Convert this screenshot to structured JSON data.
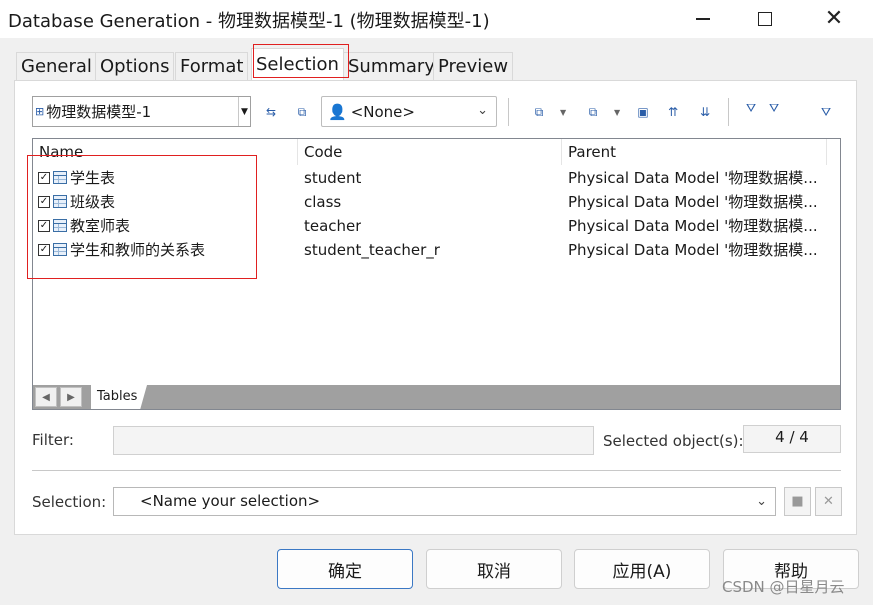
{
  "window": {
    "title": "Database Generation - 物理数据模型-1 (物理数据模型-1)"
  },
  "tabs": [
    {
      "label": "General"
    },
    {
      "label": "Options"
    },
    {
      "label": "Format"
    },
    {
      "label": "Selection"
    },
    {
      "label": "Summary"
    },
    {
      "label": "Preview"
    }
  ],
  "toolbar": {
    "model_value": "物理数据模型-1",
    "owner_value": "<None>"
  },
  "list": {
    "columns": [
      "Name",
      "Code",
      "Parent"
    ],
    "rows": [
      {
        "name": "学生表",
        "code": "student",
        "parent": "Physical Data Model '物理数据模...",
        "checked": true
      },
      {
        "name": "班级表",
        "code": "class",
        "parent": "Physical Data Model '物理数据模...",
        "checked": true
      },
      {
        "name": "教室师表",
        "code": "teacher",
        "parent": "Physical Data Model '物理数据模...",
        "checked": true
      },
      {
        "name": "学生和教师的关系表",
        "code": "student_teacher_r",
        "parent": "Physical Data Model '物理数据模...",
        "checked": true
      }
    ],
    "sheet_tab": "Tables"
  },
  "filter": {
    "label": "Filter:",
    "value": ""
  },
  "selected_objects": {
    "label": "Selected object(s):",
    "value": "4 / 4"
  },
  "selection": {
    "label": "Selection:",
    "value": "<Name your selection>"
  },
  "buttons": {
    "ok": "确定",
    "cancel": "取消",
    "apply": "应用(A)",
    "help": "帮助"
  },
  "watermark": "CSDN @日星月云",
  "colors": {
    "highlight": "#e02020",
    "default_button_border": "#3b78c4"
  }
}
